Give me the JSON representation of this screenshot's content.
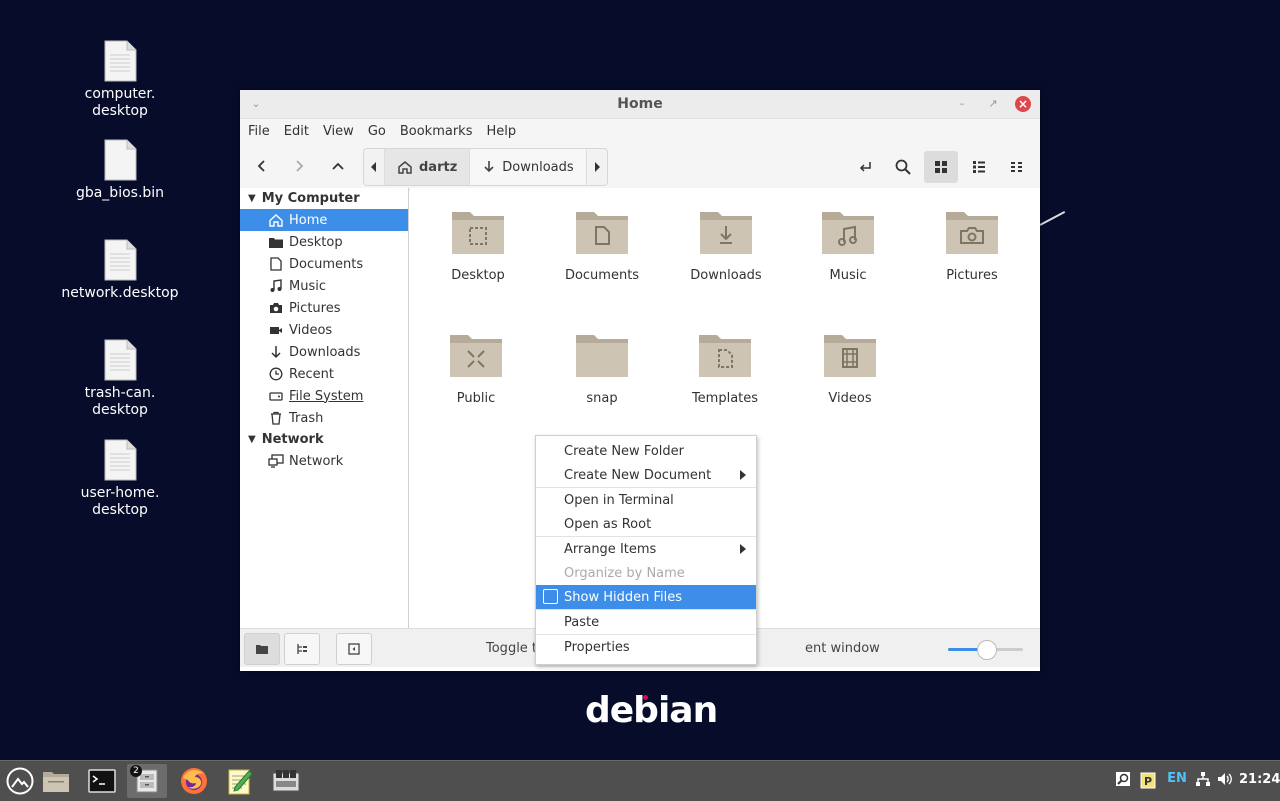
{
  "desktop": {
    "icons": [
      {
        "label_line1": "computer.",
        "label_line2": "desktop"
      },
      {
        "label_line1": "gba_bios.bin",
        "label_line2": ""
      },
      {
        "label_line1": "network.desktop",
        "label_line2": ""
      },
      {
        "label_line1": "trash-can.",
        "label_line2": "desktop"
      },
      {
        "label_line1": "user-home.",
        "label_line2": "desktop"
      }
    ],
    "wallpaper_text": "debian"
  },
  "window": {
    "title": "Home",
    "menu": [
      "File",
      "Edit",
      "View",
      "Go",
      "Bookmarks",
      "Help"
    ],
    "pathbar": {
      "crumbs": [
        "dartz",
        "Downloads"
      ],
      "active_index": 0
    },
    "sidebar": {
      "sections": [
        {
          "title": "My Computer",
          "items": [
            {
              "label": "Home",
              "icon": "home-icon",
              "selected": true
            },
            {
              "label": "Desktop",
              "icon": "desktop-icon"
            },
            {
              "label": "Documents",
              "icon": "document-icon"
            },
            {
              "label": "Music",
              "icon": "music-icon"
            },
            {
              "label": "Pictures",
              "icon": "camera-icon"
            },
            {
              "label": "Videos",
              "icon": "video-icon"
            },
            {
              "label": "Downloads",
              "icon": "download-icon"
            },
            {
              "label": "Recent",
              "icon": "clock-icon"
            },
            {
              "label": "File System",
              "icon": "drive-icon"
            },
            {
              "label": "Trash",
              "icon": "trash-icon"
            }
          ]
        },
        {
          "title": "Network",
          "items": [
            {
              "label": "Network",
              "icon": "network-icon"
            }
          ]
        }
      ]
    },
    "folders": [
      "Desktop",
      "Documents",
      "Downloads",
      "Music",
      "Pictures",
      "Public",
      "snap",
      "Templates",
      "Videos"
    ],
    "status": {
      "text_left": "Toggle t",
      "text_right": "ent window",
      "zoom_fraction": 0.5
    }
  },
  "context_menu": {
    "items": [
      "Create New Folder",
      "Create New Document",
      "Open in Terminal",
      "Open as Root",
      "Arrange Items",
      "Organize by Name",
      "Show Hidden Files",
      "Paste",
      "Properties"
    ]
  },
  "taskbar": {
    "badge": "2",
    "lang": "EN",
    "clock": "21:24"
  }
}
